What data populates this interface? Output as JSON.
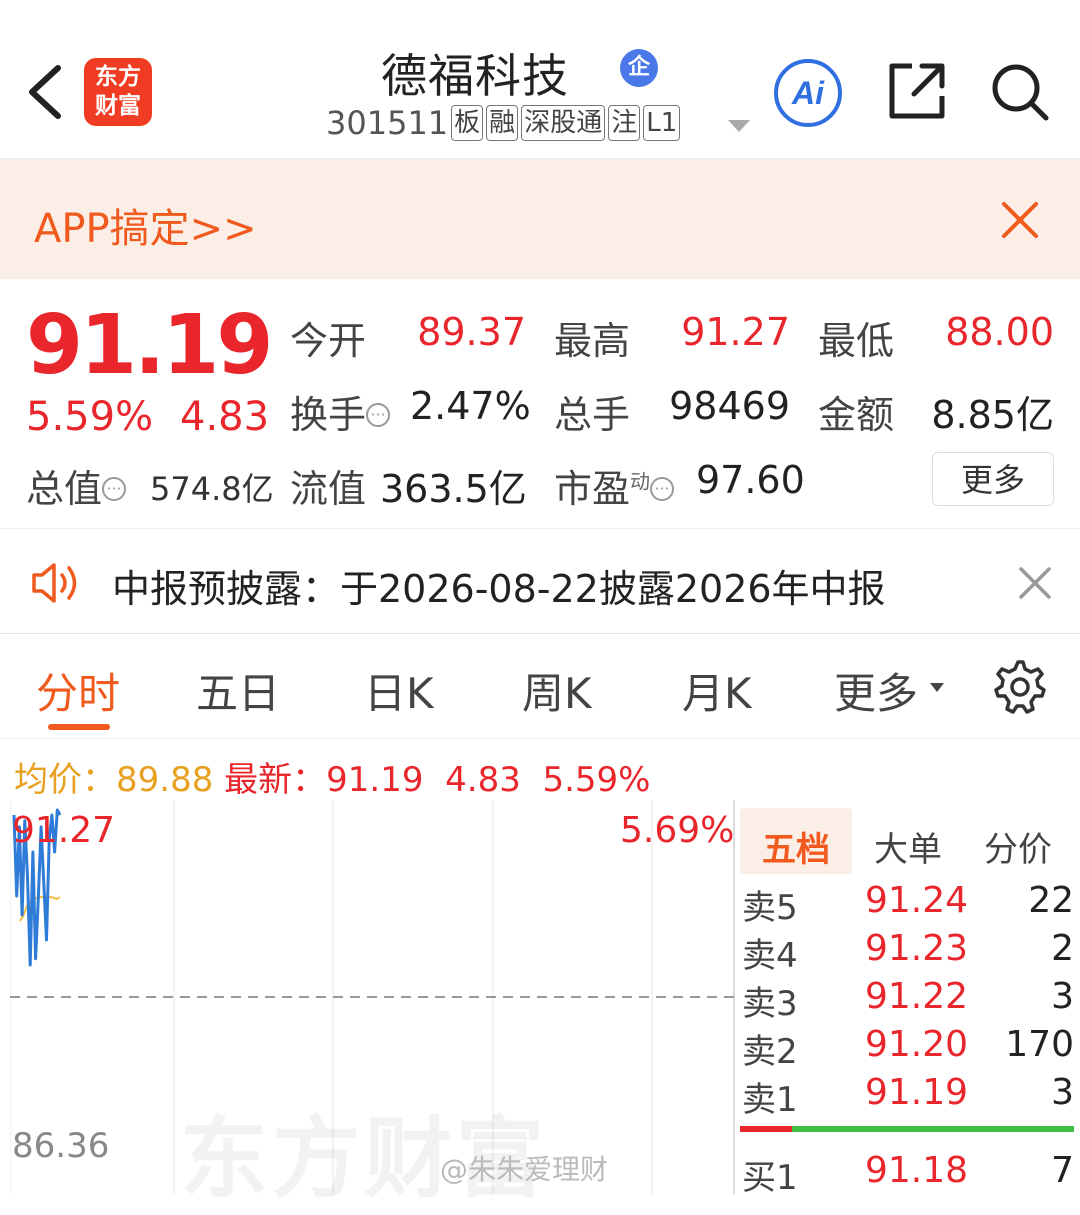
{
  "header": {
    "logo_line1": "东方",
    "logo_line2": "财富",
    "stock_name": "德福科技",
    "qi_badge": "企",
    "code": "301511",
    "tags": [
      "板",
      "融",
      "深股通",
      "注",
      "L1"
    ],
    "ai_label": "Ai"
  },
  "banner": {
    "text": "APP搞定>>"
  },
  "quote": {
    "price": "91.19",
    "change_pct": "5.59%",
    "change_val": "4.83",
    "mcap_label": "总值",
    "mcap_value": "574.8亿",
    "open_label": "今开",
    "open_value": "89.37",
    "high_label": "最高",
    "high_value": "91.27",
    "low_label": "最低",
    "low_value": "88.00",
    "turnover_label": "换手",
    "turnover_value": "2.47%",
    "volume_label": "总手",
    "volume_value": "98469",
    "amount_label": "金额",
    "amount_value": "8.85亿",
    "float_label": "流值",
    "float_value": "363.5亿",
    "pe_label": "市盈",
    "pe_sup": "动",
    "pe_value": "97.60",
    "more_label": "更多"
  },
  "notice": {
    "text": "中报预披露：于2026-08-22披露2026年中报"
  },
  "tabs": {
    "items": [
      "分时",
      "五日",
      "日K",
      "周K",
      "月K",
      "更多"
    ],
    "active": "分时"
  },
  "summary": {
    "avg_label": "均价：",
    "avg_value": "89.88",
    "latest_label": "最新：",
    "latest_value": "91.19",
    "latest_change": "4.83",
    "latest_pct": "5.59%"
  },
  "chart_data": {
    "type": "line",
    "top_label": "91.27",
    "top_pct_label": "5.69%",
    "base_label": "86.36",
    "ylim": [
      81.45,
      91.27
    ],
    "series": [
      {
        "values": [
          91.19,
          89.9,
          91.0,
          89.6,
          91.1,
          90.2,
          88.8,
          90.6,
          88.9,
          89.9,
          91.0,
          90.1,
          89.2,
          90.8,
          91.19,
          90.6,
          91.27,
          91.19
        ]
      }
    ],
    "avg_series": [
      89.5,
      89.6,
      89.75,
      89.8,
      89.85,
      89.88,
      89.88,
      89.9,
      89.88,
      89.88,
      89.85,
      89.88
    ],
    "watermark": "东方财富",
    "weibo": "@朱朱爱理财"
  },
  "orderbook": {
    "tabs": [
      "五档",
      "大单",
      "分价"
    ],
    "active_tab": "五档",
    "sells": [
      {
        "label": "卖5",
        "price": "91.24",
        "vol": "22"
      },
      {
        "label": "卖4",
        "price": "91.23",
        "vol": "2"
      },
      {
        "label": "卖3",
        "price": "91.22",
        "vol": "3"
      },
      {
        "label": "卖2",
        "price": "91.20",
        "vol": "170"
      },
      {
        "label": "卖1",
        "price": "91.19",
        "vol": "3"
      }
    ],
    "buys": [
      {
        "label": "买1",
        "price": "91.18",
        "vol": "7"
      }
    ],
    "buy_ratio": 0.16
  },
  "colors": {
    "up": "#e8262c",
    "accent": "#f05a1e",
    "line": "#2f7bd8",
    "avg_line": "#f0c040"
  }
}
